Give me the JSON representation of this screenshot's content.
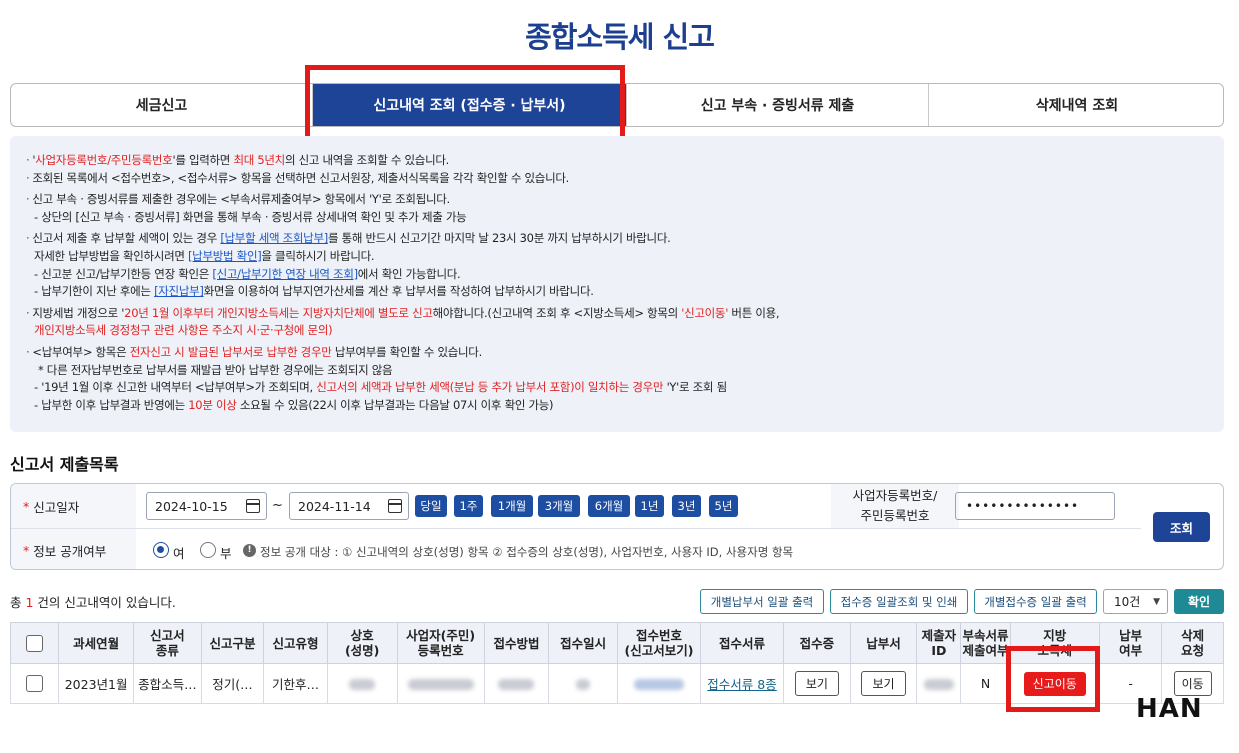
{
  "page": {
    "title": "종합소득세 신고"
  },
  "tabs": [
    {
      "label": "세금신고"
    },
    {
      "label": "신고내역 조회 (접수증 · 납부서)"
    },
    {
      "label": "신고 부속 · 증빙서류 제출"
    },
    {
      "label": "삭제내역 조회"
    }
  ],
  "notice": {
    "l1": {
      "a": "'",
      "b": "사업자등록번호/주민등록번호",
      "c": "'를 입력하면 ",
      "d": "최대 5년치",
      "e": "의 신고 내역을 조회할 수 있습니다."
    },
    "l2": "조회된 목록에서 <접수번호>, <접수서류> 항목을 선택하면 신고서원장, 제출서식목록을 각각 확인할 수 있습니다.",
    "l3": "신고 부속 · 증빙서류를 제출한 경우에는 <부속서류제출여부> 항목에서 'Y'로 조회됩니다.",
    "l4": "- 상단의 [신고 부속 · 증빙서류] 화면을 통해 부속 · 증빙서류 상세내역 확인 및 추가 제출 가능",
    "l5": {
      "a": "신고서 제출 후 납부할 세액이 있는 경우 ",
      "b": "[납부할 세액 조회납부]",
      "c": "를 통해 반드시 신고기간 마지막 날 23시 30분 까지 납부하시기 바랍니다."
    },
    "l6": {
      "a": "자세한 납부방법을 확인하시려면 ",
      "b": "[납부방법 확인]",
      "c": "을 클릭하시기 바랍니다."
    },
    "l7": {
      "a": "- 신고분 신고/납부기한등 연장 확인은 ",
      "b": "[신고/납부기한 연장 내역 조회]",
      "c": "에서 확인 가능합니다."
    },
    "l8": {
      "a": "- 납부기한이 지난 후에는 ",
      "b": "[자진납부]",
      "c": "화면을 이용하여 납부지연가산세를 계산 후 납부서를 작성하여 납부하시기 바랍니다."
    },
    "l9": {
      "a": "지방세법 개정으로 '",
      "b": "20년 1월 이후부터 개인지방소득세는 지방자치단체에 별도로 신고",
      "c": "해야합니다.(신고내역 조회 후 <지방소득세> 항목의 ",
      "d": "'신고이동'",
      "e": " 버튼 이용,"
    },
    "l10": "개인지방소득세 경정청구 관련 사항은 주소지 시·군·구청에 문의)",
    "l11": {
      "a": "<납부여부> 항목은 ",
      "b": "전자신고 시 발급된 납부서로 납부한 경우만",
      "c": " 납부여부를 확인할 수 있습니다."
    },
    "l12": "* 다른 전자납부번호로 납부서를 재발급 받아 납부한 경우에는 조회되지 않음",
    "l13": {
      "a": "- '19년 1월 이후 신고한 내역부터 <납부여부>가 조회되며, ",
      "b": "신고서의 세액과 납부한 세액(분납 등 추가 납부서 포함)이 일치하는 경우만",
      "c": " 'Y'로 조회 됨"
    },
    "l14": {
      "a": "- 납부한 이후 납부결과 반영에는 ",
      "b": "10분 이상",
      "c": " 소요될 수 있음(22시 이후 납부결과는 다음날 07시 이후 확인 가능)"
    }
  },
  "section": {
    "title": "신고서 제출목록"
  },
  "search": {
    "date_label": "신고일자",
    "date_from": "2024-10-15",
    "tilde": "~",
    "date_to": "2024-11-14",
    "quick": [
      "당일",
      "1주",
      "1개월",
      "3개월",
      "6개월",
      "1년",
      "3년",
      "5년"
    ],
    "bizno_label_1": "사업자등록번호/",
    "bizno_label_2": "주민등록번호",
    "bizno_value": "••••••••••••••",
    "search_btn": "조회",
    "disclosure_label": "정보 공개여부",
    "opt_yes": "여",
    "opt_no": "부",
    "info_icon": "!",
    "disclosure_note": "정보 공개 대상 : ① 신고내역의 상호(성명) 항목 ② 접수증의 상호(성명), 사업자번호, 사용자 ID, 사용자명 항목"
  },
  "list": {
    "count": {
      "pre": "총 ",
      "num": "1",
      "post": " 건의 신고내역이 있습니다."
    },
    "buttons": {
      "print_payment": "개별납부서 일괄 출력",
      "print_receipt": "접수증 일괄조회 및 인쇄",
      "print_receipt_each": "개별접수증 일괄 출력"
    },
    "page_size": "10건",
    "confirm": "확인"
  },
  "table": {
    "headers": {
      "period": "과세연월",
      "kind_1": "신고서",
      "kind_2": "종류",
      "type": "신고구분",
      "form": "신고유형",
      "name_1": "상호",
      "name_2": "(성명)",
      "regno_1": "사업자(주민)",
      "regno_2": "등록번호",
      "method": "접수방법",
      "time": "접수일시",
      "recno_1": "접수번호",
      "recno_2": "(신고서보기)",
      "docs": "접수서류",
      "receipt": "접수증",
      "payslip": "납부서",
      "submitter_1": "제출자",
      "submitter_2": "ID",
      "attach_1": "부속서류",
      "attach_2": "제출여부",
      "local_1": "지방",
      "local_2": "소득세",
      "paid_1": "납부",
      "paid_2": "여부",
      "delete_1": "삭제",
      "delete_2": "요청"
    },
    "row": {
      "period": "2023년1월",
      "kind": "종합소득…",
      "type": "정기(…",
      "form": "기한후…",
      "docs": "접수서류 8종",
      "receipt_btn": "보기",
      "payslip_btn": "보기",
      "attach": "N",
      "local_btn": "신고이동",
      "paid": "-",
      "delete_btn": "이동"
    }
  },
  "watermark": "HAN"
}
